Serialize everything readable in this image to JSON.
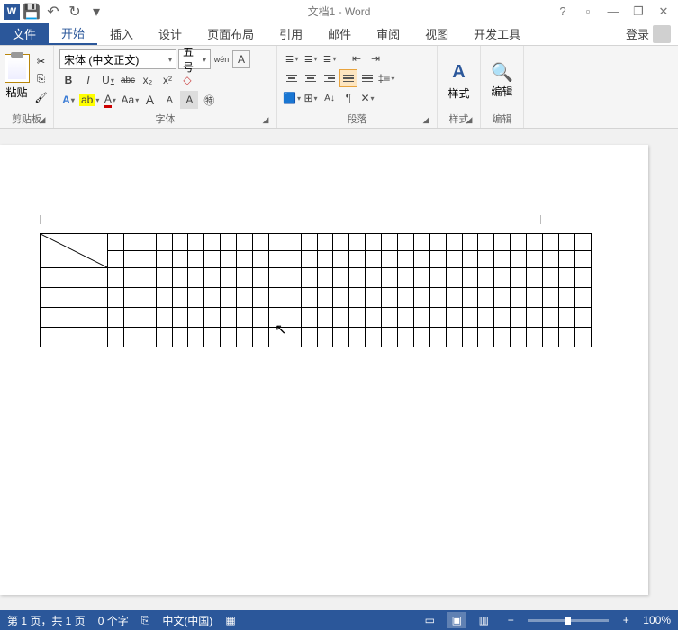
{
  "titlebar": {
    "app_icon": "W",
    "title": "文档1 - Word",
    "qat": {
      "save": "💾",
      "undo": "↶",
      "redo": "↻",
      "more": "▾"
    },
    "win": {
      "help": "?",
      "ribbon_opts": "▫",
      "min": "—",
      "restore": "❐",
      "close": "✕"
    }
  },
  "tabs": {
    "file": "文件",
    "home": "开始",
    "insert": "插入",
    "design": "设计",
    "layout": "页面布局",
    "references": "引用",
    "mail": "邮件",
    "review": "审阅",
    "view": "视图",
    "developer": "开发工具",
    "login": "登录"
  },
  "ribbon": {
    "clipboard": {
      "paste": "粘贴",
      "label": "剪贴板"
    },
    "font": {
      "name": "宋体 (中文正文)",
      "size": "五号",
      "label": "字体",
      "phonetic": "wén",
      "charborder": "A",
      "bold": "B",
      "italic": "I",
      "underline": "U",
      "strike": "abc",
      "sub": "x₂",
      "sup": "x²",
      "highlight": "ab",
      "fontcolor": "A",
      "changecase": "Aa",
      "grow": "A",
      "shrink": "A",
      "clearfmt": "A◇",
      "circled": "㊕"
    },
    "para": {
      "label": "段落",
      "bullets": "⋮≡",
      "numbers": "1≡",
      "multilevel": "≡",
      "dec_indent": "≤",
      "inc_indent": "≥",
      "sort": "A↓",
      "marks": "¶",
      "fill": "◇",
      "border": "田"
    },
    "styles": {
      "label": "样式",
      "change": "样式",
      "letter": "A"
    },
    "editing": {
      "label": "编辑",
      "find": "🔍"
    }
  },
  "statusbar": {
    "page": "第 1 页，共 1 页",
    "words": "0 个字",
    "proof": "⎘",
    "lang": "中文(中国)",
    "zoom_minus": "−",
    "zoom_plus": "+",
    "zoom": "100%"
  }
}
